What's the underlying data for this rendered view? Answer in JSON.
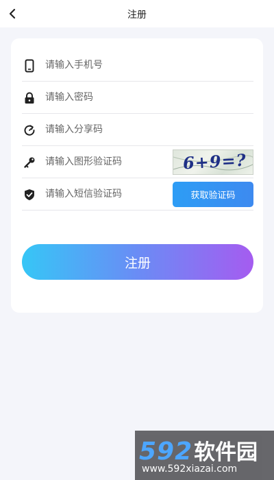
{
  "header": {
    "title": "注册",
    "back_icon": "chevron-left-icon"
  },
  "form": {
    "phone": {
      "placeholder": "请输入手机号",
      "icon": "phone-icon"
    },
    "password": {
      "placeholder": "请输入密码",
      "icon": "lock-icon"
    },
    "share_code": {
      "placeholder": "请输入分享码",
      "icon": "refresh-icon"
    },
    "image_captcha": {
      "placeholder": "请输入图形验证码",
      "icon": "key-icon",
      "captcha_text": "6+9=?"
    },
    "sms_code": {
      "placeholder": "请输入短信验证码",
      "icon": "shield-check-icon",
      "button_label": "获取验证码"
    }
  },
  "register_button": {
    "label": "注册"
  },
  "watermark": {
    "brand_number": "592",
    "brand_name": "软件园",
    "url": "www.592xiazai.com"
  },
  "colors": {
    "background": "#f4f5fa",
    "card": "#ffffff",
    "sms_button": "#3d8af0",
    "gradient_start": "#36c6f6",
    "gradient_end": "#a55cf0",
    "captcha_text": "#1e2f86"
  }
}
